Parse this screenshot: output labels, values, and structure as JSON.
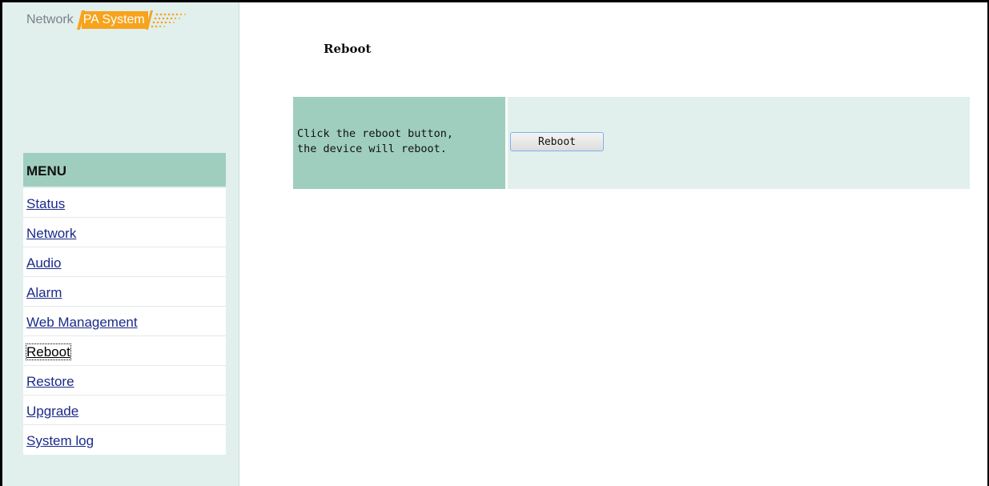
{
  "logo": {
    "network_text": "Network",
    "pa_text": "PA System"
  },
  "menu": {
    "header": "MENU",
    "items": [
      {
        "label": "Status"
      },
      {
        "label": "Network"
      },
      {
        "label": "Audio"
      },
      {
        "label": "Alarm"
      },
      {
        "label": "Web Management"
      },
      {
        "label": "Reboot",
        "active": true
      },
      {
        "label": "Restore"
      },
      {
        "label": "Upgrade"
      },
      {
        "label": "System log"
      }
    ]
  },
  "main": {
    "title": "Reboot",
    "description_lines": [
      "Click the reboot button,",
      "the device will reboot."
    ],
    "button_label": "Reboot"
  },
  "colors": {
    "sidebar_bg": "#e1efed",
    "menu_header_bg": "#9fcebf",
    "logo_accent": "#f7a31c",
    "link": "#1a2a8a"
  }
}
